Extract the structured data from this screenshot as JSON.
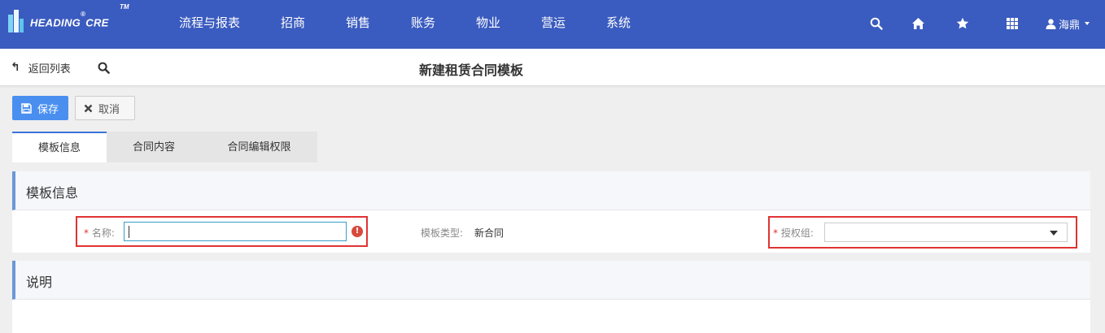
{
  "brand": {
    "name": "HEADING",
    "reg": "®",
    "suffix": "CRE",
    "tm": "TM"
  },
  "nav": [
    "流程与报表",
    "招商",
    "销售",
    "账务",
    "物业",
    "营运",
    "系统"
  ],
  "top_icons": [
    "search-icon",
    "home-icon",
    "star-icon",
    "apps-grid-icon"
  ],
  "user": {
    "name": "海鼎"
  },
  "subheader": {
    "back_label": "返回列表",
    "title": "新建租赁合同模板"
  },
  "toolbar": {
    "save_label": "保存",
    "cancel_label": "取消"
  },
  "tabs": [
    "模板信息",
    "合同内容",
    "合同编辑权限"
  ],
  "section_info": {
    "title": "模板信息",
    "name_label": "名称:",
    "name_value": "",
    "type_label": "模板类型:",
    "type_value": "新合同",
    "group_label": "授权组:",
    "group_value": "",
    "required_mark": "*",
    "error_mark": "!"
  },
  "section_desc": {
    "title": "说明"
  },
  "colors": {
    "nav_bg": "#3a5bbf",
    "primary": "#4a8ff0",
    "error": "#e03333",
    "accent_border": "#6a97d6"
  }
}
